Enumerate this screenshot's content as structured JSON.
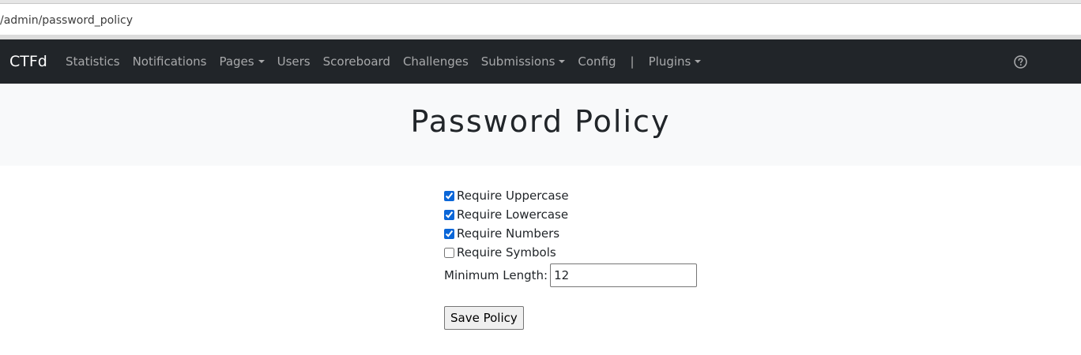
{
  "browser": {
    "url": "/admin/password_policy"
  },
  "navbar": {
    "brand": "CTFd",
    "items": [
      {
        "label": "Statistics",
        "dropdown": false
      },
      {
        "label": "Notifications",
        "dropdown": false
      },
      {
        "label": "Pages",
        "dropdown": true
      },
      {
        "label": "Users",
        "dropdown": false
      },
      {
        "label": "Scoreboard",
        "dropdown": false
      },
      {
        "label": "Challenges",
        "dropdown": false
      },
      {
        "label": "Submissions",
        "dropdown": true
      },
      {
        "label": "Config",
        "dropdown": false
      }
    ],
    "separator": "|",
    "plugins_label": "Plugins",
    "help_icon": "question-circle-icon",
    "bg_color": "#212529"
  },
  "page": {
    "title": "Password Policy"
  },
  "form": {
    "options": [
      {
        "label": "Require Uppercase",
        "checked": true
      },
      {
        "label": "Require Lowercase",
        "checked": true
      },
      {
        "label": "Require Numbers",
        "checked": true
      },
      {
        "label": "Require Symbols",
        "checked": false
      }
    ],
    "min_length_label": "Minimum Length:",
    "min_length_value": "12",
    "save_label": "Save Policy"
  }
}
